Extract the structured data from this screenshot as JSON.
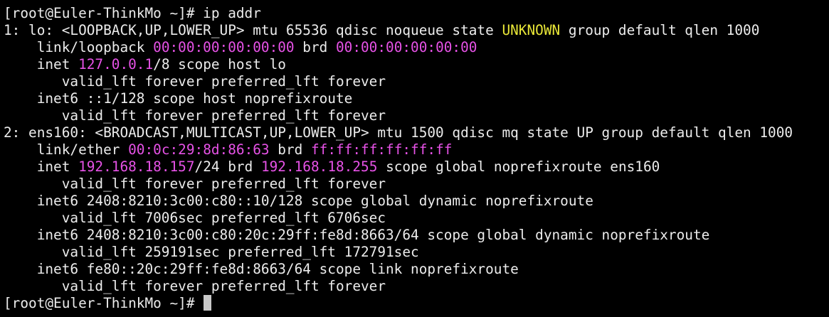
{
  "terminal": {
    "lines": [
      {
        "kind": "prompt",
        "segments": [
          {
            "text": "[root@Euler-ThinkMo ~]# ip addr",
            "color": "normal"
          }
        ]
      },
      {
        "kind": "output",
        "segments": [
          {
            "text": "1: lo: <LOOPBACK,UP,LOWER_UP> mtu 65536 qdisc noqueue state ",
            "color": "normal"
          },
          {
            "text": "UNKNOWN",
            "color": "yellow"
          },
          {
            "text": " group default qlen 1000",
            "color": "normal"
          }
        ]
      },
      {
        "kind": "output",
        "segments": [
          {
            "text": "    link/loopback ",
            "color": "normal"
          },
          {
            "text": "00:00:00:00:00:00",
            "color": "magenta"
          },
          {
            "text": " brd ",
            "color": "normal"
          },
          {
            "text": "00:00:00:00:00:00",
            "color": "magenta"
          }
        ]
      },
      {
        "kind": "output",
        "segments": [
          {
            "text": "    inet ",
            "color": "normal"
          },
          {
            "text": "127.0.0.1",
            "color": "magenta"
          },
          {
            "text": "/8 scope host lo",
            "color": "normal"
          }
        ]
      },
      {
        "kind": "output",
        "segments": [
          {
            "text": "       valid_lft forever preferred_lft forever",
            "color": "normal"
          }
        ]
      },
      {
        "kind": "output",
        "segments": [
          {
            "text": "    inet6 ::1/128 scope host noprefixroute",
            "color": "normal"
          }
        ]
      },
      {
        "kind": "output",
        "segments": [
          {
            "text": "       valid_lft forever preferred_lft forever",
            "color": "normal"
          }
        ]
      },
      {
        "kind": "output",
        "segments": [
          {
            "text": "2: ens160: <BROADCAST,MULTICAST,UP,LOWER_UP> mtu 1500 qdisc mq state UP group default qlen 1000",
            "color": "normal"
          }
        ]
      },
      {
        "kind": "output",
        "segments": [
          {
            "text": "    link/ether ",
            "color": "normal"
          },
          {
            "text": "00:0c:29:8d:86:63",
            "color": "magenta"
          },
          {
            "text": " brd ",
            "color": "normal"
          },
          {
            "text": "ff:ff:ff:ff:ff:ff",
            "color": "magenta"
          }
        ]
      },
      {
        "kind": "output",
        "segments": [
          {
            "text": "    inet ",
            "color": "normal"
          },
          {
            "text": "192.168.18.157",
            "color": "magenta"
          },
          {
            "text": "/24 brd ",
            "color": "normal"
          },
          {
            "text": "192.168.18.255",
            "color": "magenta"
          },
          {
            "text": " scope global noprefixroute ens160",
            "color": "normal"
          }
        ]
      },
      {
        "kind": "output",
        "segments": [
          {
            "text": "       valid_lft forever preferred_lft forever",
            "color": "normal"
          }
        ]
      },
      {
        "kind": "output",
        "segments": [
          {
            "text": "    inet6 2408:8210:3c00:c80::10/128 scope global dynamic noprefixroute",
            "color": "normal"
          }
        ]
      },
      {
        "kind": "output",
        "segments": [
          {
            "text": "       valid_lft 7006sec preferred_lft 6706sec",
            "color": "normal"
          }
        ]
      },
      {
        "kind": "output",
        "segments": [
          {
            "text": "    inet6 2408:8210:3c00:c80:20c:29ff:fe8d:8663/64 scope global dynamic noprefixroute",
            "color": "normal"
          }
        ]
      },
      {
        "kind": "output",
        "segments": [
          {
            "text": "       valid_lft 259191sec preferred_lft 172791sec",
            "color": "normal"
          }
        ]
      },
      {
        "kind": "output",
        "segments": [
          {
            "text": "    inet6 fe80::20c:29ff:fe8d:8663/64 scope link noprefixroute",
            "color": "normal"
          }
        ]
      },
      {
        "kind": "output",
        "segments": [
          {
            "text": "       valid_lft forever preferred_lft forever",
            "color": "normal"
          }
        ]
      },
      {
        "kind": "prompt",
        "segments": [
          {
            "text": "[root@Euler-ThinkMo ~]# ",
            "color": "normal"
          }
        ],
        "cursor": true
      }
    ]
  },
  "colors": {
    "background": "#000000",
    "foreground": "#ececec",
    "magenta": "#e752e7",
    "yellow": "#e8e637",
    "cursor": "#c8c8c8"
  }
}
